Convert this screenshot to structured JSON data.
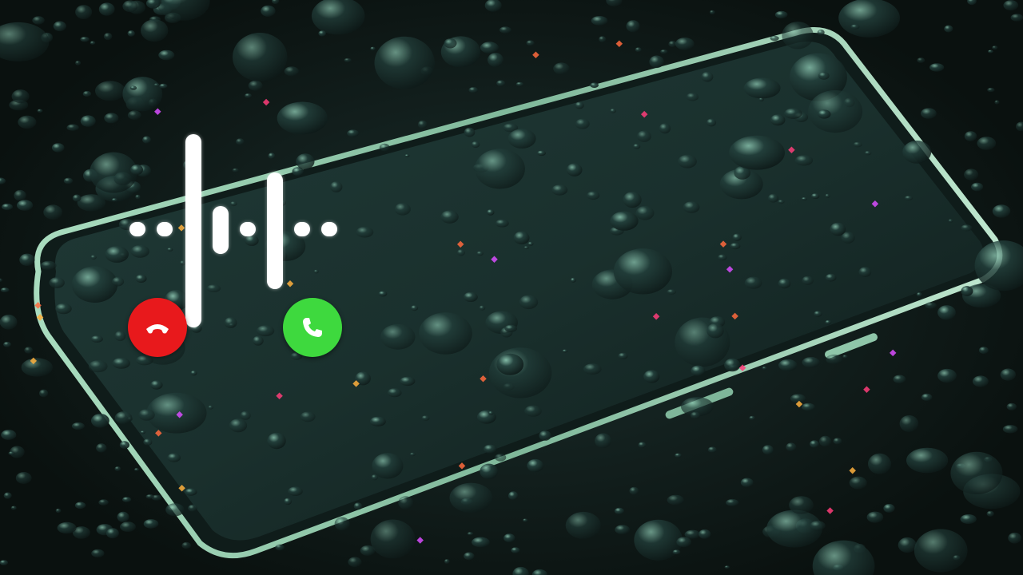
{
  "call_screen": {
    "decline_button": {
      "icon": "phone-hangup-icon",
      "color": "#e8191c"
    },
    "accept_button": {
      "icon": "phone-icon",
      "color": "#3ed93e"
    },
    "waveform": {
      "color": "#ffffff"
    }
  },
  "background": {
    "description_icon": "smartphone-with-water-drops",
    "accent_color": "#9fd9b4"
  }
}
